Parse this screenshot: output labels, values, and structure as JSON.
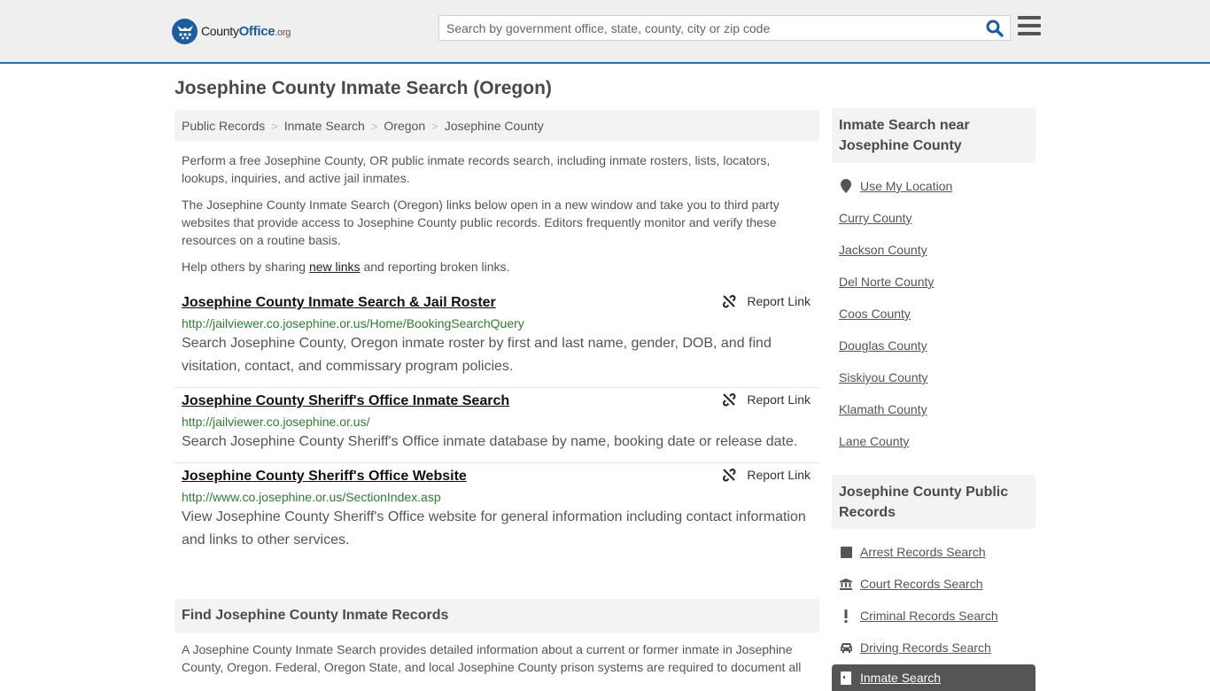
{
  "header": {
    "logo": {
      "name_part1": "County",
      "name_part2": "Office",
      "name_part3": ".org"
    },
    "search": {
      "placeholder": "Search by government office, state, county, city or zip code",
      "value": ""
    },
    "colors": {
      "brand": "#1c5d9e",
      "accent_border": "#2a6fae"
    }
  },
  "page": {
    "title": "Josephine County Inmate Search (Oregon)",
    "breadcrumb": [
      "Public Records",
      "Inmate Search",
      "Oregon",
      "Josephine County"
    ],
    "intro": {
      "p1": "Perform a free Josephine County, OR public inmate records search, including inmate rosters, lists, locators, lookups, inquiries, and active jail inmates.",
      "p2": "The Josephine County Inmate Search (Oregon) links below open in a new window and take you to third party websites that provide access to Josephine County public records. Editors frequently monitor and verify these resources on a routine basis.",
      "p3_before": "Help others by sharing ",
      "p3_link": "new links",
      "p3_after": " and reporting broken links."
    },
    "results": [
      {
        "title": "Josephine County Inmate Search & Jail Roster",
        "url": "http://jailviewer.co.josephine.or.us/Home/BookingSearchQuery",
        "description": "Search Josephine County, Oregon inmate roster by first and last name, gender, DOB, and find visitation, contact, and commissary program policies.",
        "report_label": "Report Link"
      },
      {
        "title": "Josephine County Sheriff's Office Inmate Search",
        "url": "http://jailviewer.co.josephine.or.us/",
        "description": "Search Josephine County Sheriff's Office inmate database by name, booking date or release date.",
        "report_label": "Report Link"
      },
      {
        "title": "Josephine County Sheriff's Office Website",
        "url": "http://www.co.josephine.or.us/SectionIndex.asp",
        "description": "View Josephine County Sheriff's Office website for general information including contact information and links to other services.",
        "report_label": "Report Link"
      }
    ],
    "find_section": {
      "heading": "Find Josephine County Inmate Records",
      "text": "A Josephine County Inmate Search provides detailed information about a current or former inmate in Josephine County, Oregon. Federal, Oregon State, and local Josephine County prison systems are required to document all"
    }
  },
  "sidebar": {
    "nearby": {
      "heading": "Inmate Search near Josephine County",
      "use_location": "Use My Location",
      "counties": [
        "Curry County",
        "Jackson County",
        "Del Norte County",
        "Coos County",
        "Douglas County",
        "Siskiyou County",
        "Klamath County",
        "Lane County"
      ]
    },
    "public_records": {
      "heading": "Josephine County Public Records",
      "items": [
        {
          "label": "Arrest Records Search",
          "icon": "square-icon"
        },
        {
          "label": "Court Records Search",
          "icon": "courthouse-icon"
        },
        {
          "label": "Criminal Records Search",
          "icon": "exclamation-icon"
        },
        {
          "label": "Driving Records Search",
          "icon": "car-icon"
        }
      ],
      "active_item": {
        "label": "Inmate Search",
        "icon": "door-icon"
      }
    }
  }
}
